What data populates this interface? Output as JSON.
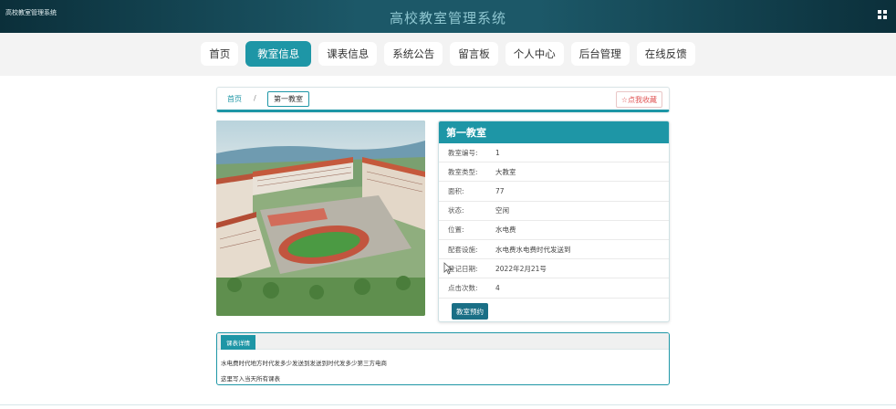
{
  "header": {
    "system_name_small": "高校教室管理系统",
    "title": "高校教室管理系统",
    "menu_icon": "grid-icon"
  },
  "nav": {
    "items": [
      {
        "label": "首页",
        "active": false
      },
      {
        "label": "教室信息",
        "active": true
      },
      {
        "label": "课表信息",
        "active": false
      },
      {
        "label": "系统公告",
        "active": false
      },
      {
        "label": "留言板",
        "active": false
      },
      {
        "label": "个人中心",
        "active": false
      },
      {
        "label": "后台管理",
        "active": false
      },
      {
        "label": "在线反馈",
        "active": false
      }
    ]
  },
  "breadcrumb": {
    "home": "首页",
    "separator": "/",
    "current": "第一教室",
    "favorite_label": "☆点我收藏"
  },
  "room": {
    "title": "第一教室",
    "fields": [
      {
        "key": "教室编号:",
        "value": "1"
      },
      {
        "key": "教室类型:",
        "value": "大教室"
      },
      {
        "key": "面积:",
        "value": "77"
      },
      {
        "key": "状态:",
        "value": "空闲"
      },
      {
        "key": "位置:",
        "value": "水电费"
      },
      {
        "key": "配套设施:",
        "value": "水电费水电费时代发送到"
      },
      {
        "key": "登记日期:",
        "value": "2022年2月21号"
      },
      {
        "key": "点击次数:",
        "value": "4"
      }
    ],
    "book_button": "教室预约"
  },
  "details": {
    "tab_label": "课表详情",
    "line1": "水电费时代地方时代发多少发送到发送到时代发多少第三方电商",
    "line2": "这里写入当天所有课表"
  },
  "colors": {
    "accent": "#1e96a6",
    "topbar": "#1c5868",
    "book_button": "#1a6f86",
    "favorite": "#e05656"
  }
}
